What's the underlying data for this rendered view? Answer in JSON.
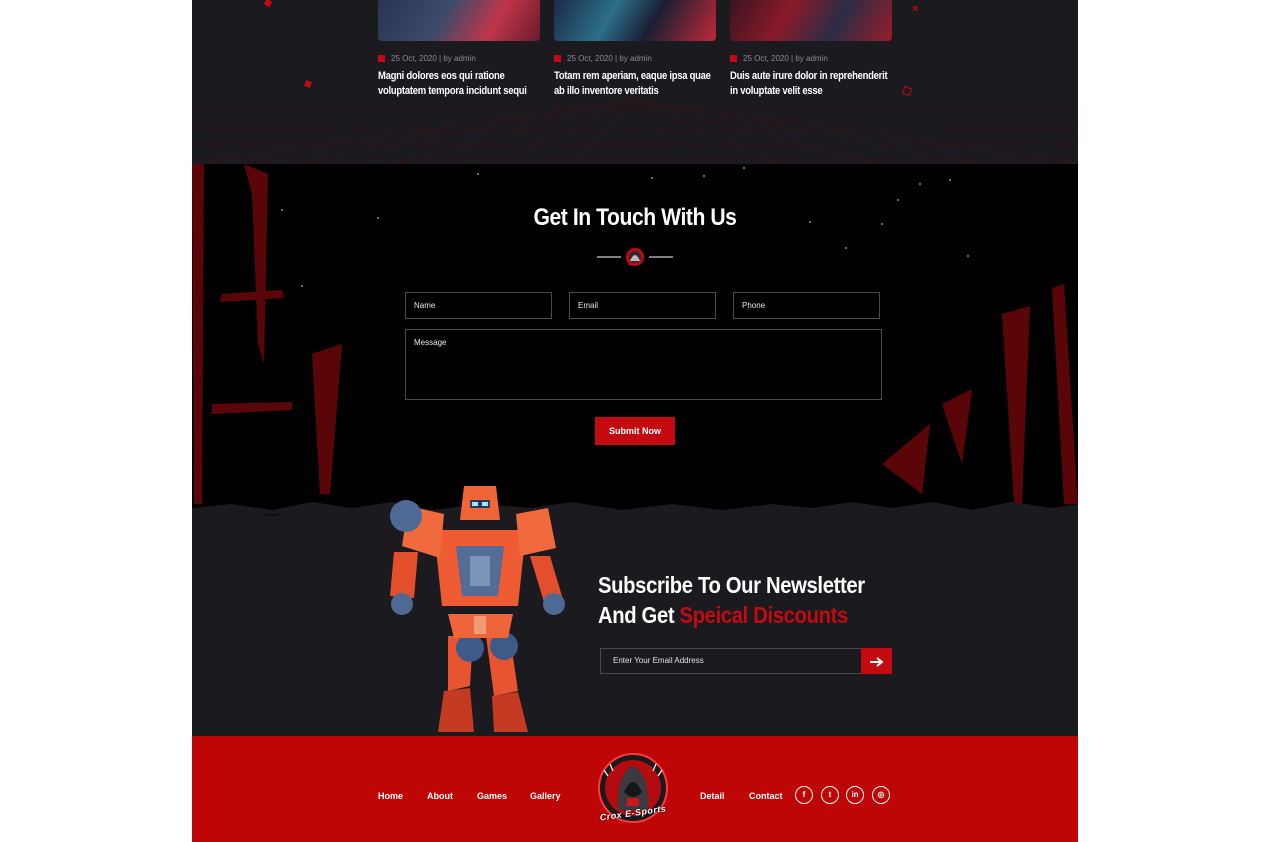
{
  "blog": {
    "posts": [
      {
        "meta": "25 Oct, 2020 | by admin",
        "title": "Magni dolores eos qui ratione voluptatem tempora incidunt sequi"
      },
      {
        "meta": "25 Oct, 2020 | by admin",
        "title": "Totam rem aperiam, eaque ipsa quae ab illo inventore veritatis"
      },
      {
        "meta": "25 Oct, 2020 | by admin",
        "title": "Duis aute irure dolor in reprehenderit in voluptate velit esse"
      }
    ]
  },
  "contact": {
    "heading": "Get In Touch With Us",
    "fields": {
      "name": "Name",
      "email": "Email",
      "phone": "Phone",
      "message": "Message"
    },
    "submit_label": "Submit Now"
  },
  "newsletter": {
    "title_line1": "Subscribe To Our Newsletter",
    "title_line2_prefix": "And Get ",
    "title_line2_highlight": "Speical Discounts",
    "email_placeholder": "Enter Your Email Address",
    "submit_icon": "arrow-right-icon"
  },
  "footer": {
    "nav_left": [
      "Home",
      "About",
      "Games",
      "Gallery"
    ],
    "nav_right": [
      "Detail",
      "Contact"
    ],
    "logo_text": "Crox E-Sports",
    "social": [
      {
        "icon": "facebook-icon",
        "glyph": "f"
      },
      {
        "icon": "twitter-icon",
        "glyph": "t"
      },
      {
        "icon": "linkedin-icon",
        "glyph": "in"
      },
      {
        "icon": "instagram-icon",
        "glyph": "◎"
      }
    ]
  },
  "colors": {
    "accent": "#c20a10",
    "footer_bg": "#bf0606",
    "dark_bg": "#1b1a1f",
    "black_bg": "#000000"
  }
}
